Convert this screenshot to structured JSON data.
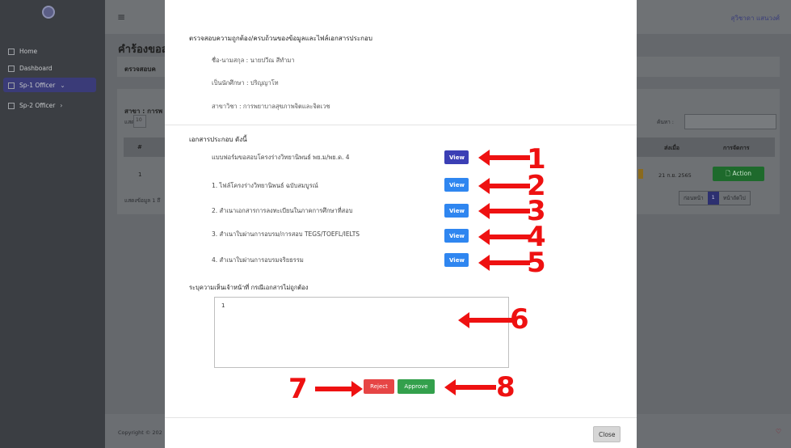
{
  "sidebar": {
    "items": [
      {
        "label": "Home"
      },
      {
        "label": "Dashboard"
      },
      {
        "label": "Sp-1 Officer"
      },
      {
        "label": "Sp-2 Officer"
      }
    ]
  },
  "header": {
    "user_name": "สุวิชาดา แสนวงศ์"
  },
  "page": {
    "title": "คำร้องขอส",
    "card1_title": "ตรวจสอบค",
    "card2_title": "สาขา : การพ",
    "show_label": "แสดง",
    "show_value": "10",
    "search_label": "ค้นหา :",
    "table": {
      "headers": {
        "num": "#",
        "sent": "ส่งเมื่อ",
        "manage": "การจัดการ"
      },
      "row": {
        "num": "1",
        "date": "21 ก.ย. 2565",
        "action": "Action"
      }
    },
    "showing": "แสดงข้อมูล 1 ถึ",
    "pager": {
      "prev": "ก่อนหน้า",
      "current": "1",
      "next": "หน้าถัดไป"
    },
    "copyright": "Copyright © 202"
  },
  "modal": {
    "title": "ตรวจสอบความถูกต้อง/ครบถ้วนของข้อมูลและไฟล์เอกสารประกอบ",
    "name": "ชื่อ-นามสกุล : นายปวีณ สีทำมา",
    "student_type": "เป็นนักศึกษา : ปริญญาโท",
    "major": "สาขาวิชา : การพยาบาลสุขภาพจิตและจิตเวช",
    "docs_heading": "เอกสารประกอบ ดังนี้",
    "documents": [
      {
        "label": "แบบฟอร์มขอสอบโครงร่างวิทยานิพนธ์ พย.ม/พย.ด. 4",
        "button": "View"
      },
      {
        "label": "1. ไฟล์โครงร่างวิทยานิพนธ์ ฉบับสมบูรณ์",
        "button": "View"
      },
      {
        "label": "2. สำเนาเอกสารการลงทะเบียนในภาคการศึกษาที่สอบ",
        "button": "View"
      },
      {
        "label": "3. สำเนาใบผ่านการอบรม/การสอบ TEGS/TOEFL/IELTS",
        "button": "View"
      },
      {
        "label": "4. สำเนาใบผ่านการอบรมจริยธรรม",
        "button": "View"
      }
    ],
    "remark_label": "ระบุความเห็นเจ้าหน้าที่ กรณีเอกสารไม่ถูกต้อง",
    "remark_value": "1",
    "reject_label": "Reject",
    "approve_label": "Approve",
    "close_label": "Close"
  },
  "annotations": [
    "1",
    "2",
    "3",
    "4",
    "5",
    "6",
    "7",
    "8"
  ]
}
